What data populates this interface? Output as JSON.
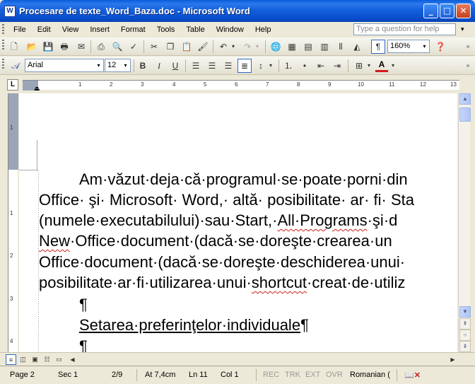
{
  "window": {
    "title": "Procesare de texte_Word_Baza.doc - Microsoft Word",
    "app_icon": "W",
    "controls": {
      "minimize": "_",
      "maximize": "□",
      "close": "✕"
    }
  },
  "menu": {
    "items": [
      "File",
      "Edit",
      "View",
      "Insert",
      "Format",
      "Tools",
      "Table",
      "Window",
      "Help"
    ],
    "help_placeholder": "Type a question for help"
  },
  "toolbar_standard": {
    "zoom": "160%",
    "icons": [
      "new-document-icon",
      "open-icon",
      "save-icon",
      "permission-icon",
      "email-icon",
      "print-icon",
      "print-preview-icon",
      "spelling-icon",
      "research-icon",
      "cut-icon",
      "copy-icon",
      "paste-icon",
      "format-painter-icon",
      "undo-icon",
      "redo-icon",
      "hyperlink-icon",
      "tables-borders-icon",
      "insert-table-icon",
      "insert-excel-icon",
      "columns-icon",
      "drawing-icon",
      "show-hide-icon",
      "help-icon"
    ]
  },
  "toolbar_formatting": {
    "font": "Arial",
    "size": "12",
    "bold": "B",
    "italic": "I",
    "underline": "U",
    "font_color": "A",
    "font_color_hex": "#d81818"
  },
  "ruler": {
    "tab_selector": "L",
    "h_numbers": [
      "1",
      "2",
      "3",
      "4",
      "5",
      "6",
      "7",
      "8",
      "9",
      "10",
      "11",
      "12",
      "13"
    ],
    "v_numbers": [
      "1",
      "1",
      "2",
      "3",
      "4"
    ]
  },
  "document": {
    "lines": [
      "Am·văzut·deja·că·programul·se·poate·porni·din",
      "Office· şi· Microsoft· Word,· altă· posibilitate· ar· fi· Sta",
      "(numele·executabilului)·sau·Start,·All·Programs·şi·d",
      "New·Office·document·(dacă·se·doreşte·crearea·un",
      "Office·document·(dacă·se·doreşte·deschiderea·unui·",
      "posibilitate·ar·fi·utilizarea·unui·shortcut·creat·de·utiliz"
    ],
    "pilcrow_1": "¶",
    "heading": "Setarea·preferinţelor·individuale",
    "heading_pilcrow": "¶",
    "pilcrow_2": "¶"
  },
  "statusbar": {
    "page": "Page 2",
    "sec": "Sec 1",
    "pages": "2/9",
    "at": "At 7,4cm",
    "ln": "Ln 11",
    "col": "Col 1",
    "rec": "REC",
    "trk": "TRK",
    "ext": "EXT",
    "ovr": "OVR",
    "language": "Romanian ("
  }
}
